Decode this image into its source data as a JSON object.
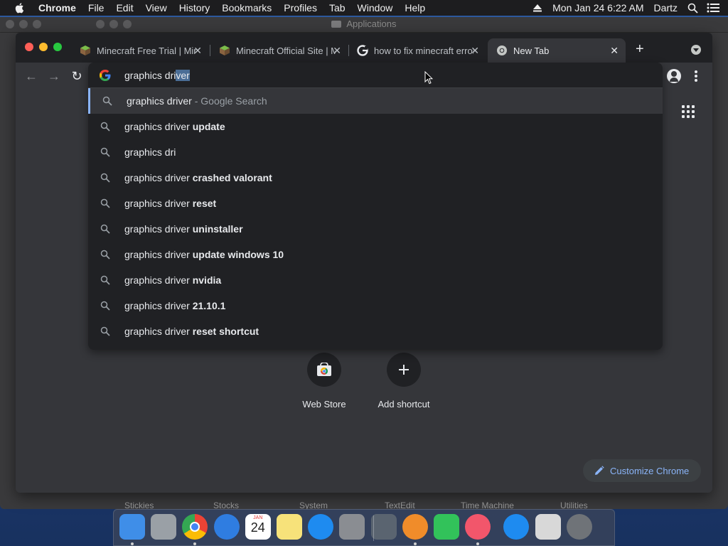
{
  "menubar": {
    "app": "Chrome",
    "items": [
      "File",
      "Edit",
      "View",
      "History",
      "Bookmarks",
      "Profiles",
      "Tab",
      "Window",
      "Help"
    ],
    "clock": "Mon Jan 24  6:22 AM",
    "user": "Dartz"
  },
  "background_window": {
    "title": "Applications",
    "bottom_labels": [
      "Stickies",
      "Stocks",
      "System",
      "TextEdit",
      "Time Machine",
      "Utilities"
    ]
  },
  "tabs": [
    {
      "title": "Minecraft Free Trial | Minecraft",
      "icon": "minecraft-grass-icon",
      "active": false
    },
    {
      "title": "Minecraft Official Site | Minecraft",
      "icon": "minecraft-grass-icon",
      "active": false
    },
    {
      "title": "how to fix minecraft error - Google Search",
      "icon": "google-icon",
      "active": false
    },
    {
      "title": "New Tab",
      "icon": "chrome-icon",
      "active": true
    }
  ],
  "omnibox": {
    "typed": "graphics dri",
    "autocompleted": "ver",
    "suggestions": [
      {
        "prefix": "graphics driver",
        "suffix": "",
        "meta": " - Google Search"
      },
      {
        "prefix": "graphics driver",
        "suffix": " update",
        "meta": ""
      },
      {
        "prefix": "graphics dri",
        "suffix": "",
        "meta": ""
      },
      {
        "prefix": "graphics driver",
        "suffix": " crashed valorant",
        "meta": ""
      },
      {
        "prefix": "graphics driver",
        "suffix": " reset",
        "meta": ""
      },
      {
        "prefix": "graphics driver",
        "suffix": " uninstaller",
        "meta": ""
      },
      {
        "prefix": "graphics driver",
        "suffix": " update windows 10",
        "meta": ""
      },
      {
        "prefix": "graphics driver",
        "suffix": " nvidia",
        "meta": ""
      },
      {
        "prefix": "graphics driver",
        "suffix": " 21.10.1",
        "meta": ""
      },
      {
        "prefix": "graphics driver",
        "suffix": " reset shortcut",
        "meta": ""
      }
    ]
  },
  "ntp": {
    "shortcuts": [
      {
        "label": "Web Store",
        "icon": "web-store-icon"
      },
      {
        "label": "Add shortcut",
        "icon": "plus-icon"
      }
    ],
    "customize_label": "Customize Chrome"
  },
  "colors": {
    "accent": "#8ab4f8",
    "window_bg": "#35363a",
    "tabstrip_bg": "#202124"
  },
  "dock": [
    "finder-icon",
    "launchpad-icon",
    "chrome-icon",
    "safari-icon",
    "calendar-icon",
    "notes-icon",
    "app-store-icon",
    "system-preferences-icon",
    "instruments-icon",
    "books-icon",
    "facetime-icon",
    "music-icon",
    "app-store-icon",
    "file-icon",
    "trash-icon"
  ],
  "dock_calendar": {
    "month": "JAN",
    "day": "24"
  }
}
